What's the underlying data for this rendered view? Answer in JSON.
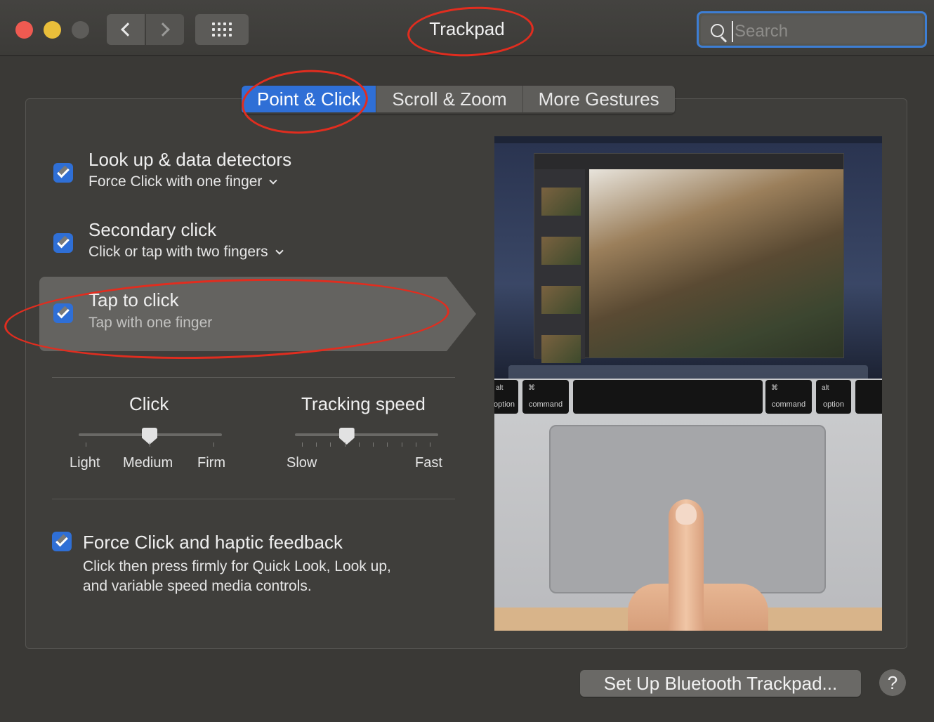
{
  "window": {
    "title": "Trackpad",
    "search_placeholder": "Search"
  },
  "tabs": [
    {
      "label": "Point & Click",
      "active": true
    },
    {
      "label": "Scroll & Zoom",
      "active": false
    },
    {
      "label": "More Gestures",
      "active": false
    }
  ],
  "options": [
    {
      "title": "Look up & data detectors",
      "subtitle": "Force Click with one finger",
      "checked": true,
      "has_dropdown": true
    },
    {
      "title": "Secondary click",
      "subtitle": "Click or tap with two fingers",
      "checked": true,
      "has_dropdown": true
    },
    {
      "title": "Tap to click",
      "subtitle": "Tap with one finger",
      "checked": true,
      "has_dropdown": false,
      "selected": true
    }
  ],
  "click_slider": {
    "title": "Click",
    "labels": [
      "Light",
      "Medium",
      "Firm"
    ],
    "value": "Medium"
  },
  "tracking_slider": {
    "title": "Tracking speed",
    "min_label": "Slow",
    "max_label": "Fast",
    "value_fraction": 0.35
  },
  "force_click": {
    "title": "Force Click and haptic feedback",
    "description_line1": "Click then press firmly for Quick Look, Look up,",
    "description_line2": "and variable speed media controls.",
    "checked": true
  },
  "preview": {
    "keys": [
      {
        "sym": "alt",
        "label": "option"
      },
      {
        "sym": "⌘",
        "label": "command"
      },
      {
        "sym": "⌘",
        "label": "command"
      },
      {
        "sym": "alt",
        "label": "option"
      }
    ]
  },
  "footer": {
    "setup_button": "Set Up Bluetooth Trackpad...",
    "help_button": "?"
  },
  "colors": {
    "accent": "#2f6fd6",
    "annotation": "#e12d1f"
  }
}
